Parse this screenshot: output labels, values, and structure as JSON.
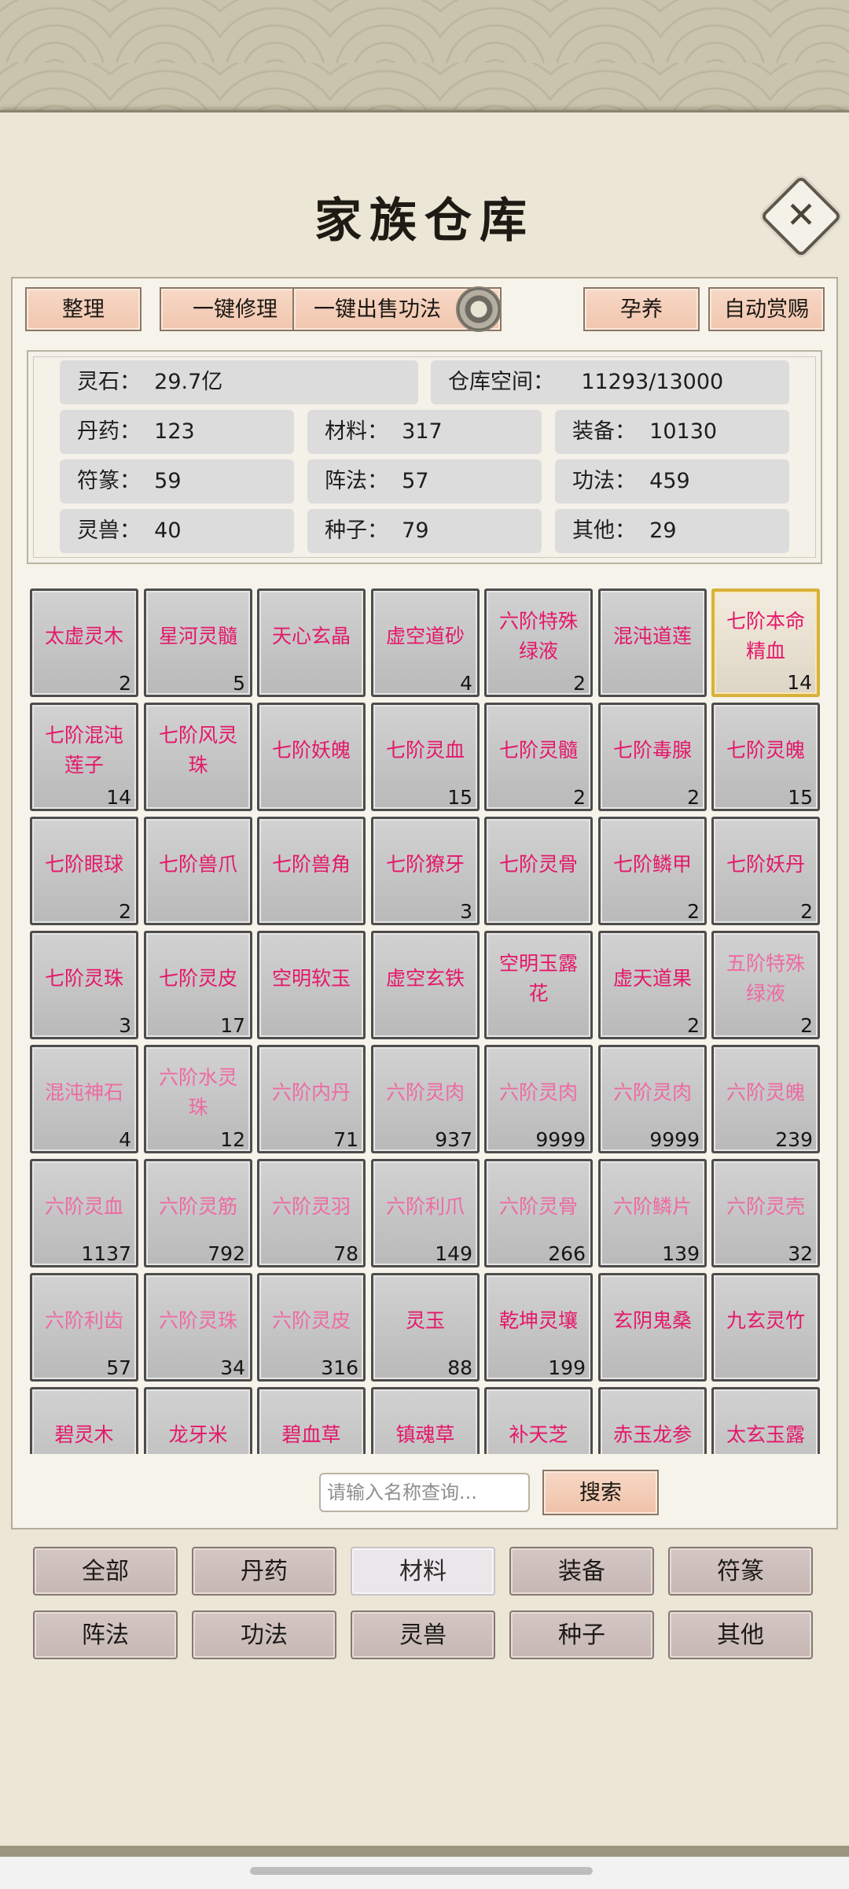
{
  "title": "家族仓库",
  "toolbar": {
    "sort": "整理",
    "repair_all": "一键修理",
    "sell_skills": "一键出售功法",
    "nurture": "孕养",
    "auto_reward": "自动赏赐"
  },
  "stats": {
    "spirit_stone": "灵石：  29.7亿",
    "capacity": "仓库空间：    11293/13000",
    "pills": "丹药：  123",
    "materials": "材料：  317",
    "equipment": "装备：  10130",
    "talismans": "符篆：  59",
    "formations": "阵法：  57",
    "skills": "功法：  459",
    "beasts": "灵兽：  40",
    "seeds": "种子：  79",
    "other": "其他：  29"
  },
  "items": [
    {
      "name": "太虚灵木",
      "count": "2"
    },
    {
      "name": "星河灵髓",
      "count": "5"
    },
    {
      "name": "天心玄晶",
      "count": ""
    },
    {
      "name": "虚空道砂",
      "count": "4"
    },
    {
      "name": "六阶特殊绿液",
      "count": "2"
    },
    {
      "name": "混沌道莲",
      "count": ""
    },
    {
      "name": "七阶本命精血",
      "count": "14"
    },
    {
      "name": "七阶混沌莲子",
      "count": "14"
    },
    {
      "name": "七阶风灵珠",
      "count": ""
    },
    {
      "name": "七阶妖魄",
      "count": ""
    },
    {
      "name": "七阶灵血",
      "count": "15"
    },
    {
      "name": "七阶灵髓",
      "count": "2"
    },
    {
      "name": "七阶毒腺",
      "count": "2"
    },
    {
      "name": "七阶灵魄",
      "count": "15"
    },
    {
      "name": "七阶眼球",
      "count": "2"
    },
    {
      "name": "七阶兽爪",
      "count": ""
    },
    {
      "name": "七阶兽角",
      "count": ""
    },
    {
      "name": "七阶獠牙",
      "count": "3"
    },
    {
      "name": "七阶灵骨",
      "count": ""
    },
    {
      "name": "七阶鳞甲",
      "count": "2"
    },
    {
      "name": "七阶妖丹",
      "count": "2"
    },
    {
      "name": "七阶灵珠",
      "count": "3"
    },
    {
      "name": "七阶灵皮",
      "count": "17"
    },
    {
      "name": "空明软玉",
      "count": ""
    },
    {
      "name": "虚空玄铁",
      "count": ""
    },
    {
      "name": "空明玉露花",
      "count": ""
    },
    {
      "name": "虚天道果",
      "count": "2"
    },
    {
      "name": "五阶特殊绿液",
      "count": "2"
    },
    {
      "name": "混沌神石",
      "count": "4"
    },
    {
      "name": "六阶水灵珠",
      "count": "12"
    },
    {
      "name": "六阶内丹",
      "count": "71"
    },
    {
      "name": "六阶灵肉",
      "count": "937"
    },
    {
      "name": "六阶灵肉",
      "count": "9999"
    },
    {
      "name": "六阶灵肉",
      "count": "9999"
    },
    {
      "name": "六阶灵魄",
      "count": "239"
    },
    {
      "name": "六阶灵血",
      "count": "1137"
    },
    {
      "name": "六阶灵筋",
      "count": "792"
    },
    {
      "name": "六阶灵羽",
      "count": "78"
    },
    {
      "name": "六阶利爪",
      "count": "149"
    },
    {
      "name": "六阶灵骨",
      "count": "266"
    },
    {
      "name": "六阶鳞片",
      "count": "139"
    },
    {
      "name": "六阶灵壳",
      "count": "32"
    },
    {
      "name": "六阶利齿",
      "count": "57"
    },
    {
      "name": "六阶灵珠",
      "count": "34"
    },
    {
      "name": "六阶灵皮",
      "count": "316"
    },
    {
      "name": "灵玉",
      "count": "88"
    },
    {
      "name": "乾坤灵壤",
      "count": "199"
    },
    {
      "name": "玄阴鬼桑",
      "count": ""
    },
    {
      "name": "九玄灵竹",
      "count": ""
    },
    {
      "name": "碧灵木",
      "count": ""
    },
    {
      "name": "龙牙米",
      "count": ""
    },
    {
      "name": "碧血草",
      "count": ""
    },
    {
      "name": "镇魂草",
      "count": ""
    },
    {
      "name": "补天芝",
      "count": ""
    },
    {
      "name": "赤玉龙参",
      "count": ""
    },
    {
      "name": "太玄玉露",
      "count": ""
    }
  ],
  "search": {
    "placeholder": "请输入名称查询...",
    "button": "搜索"
  },
  "categories": [
    "全部",
    "丹药",
    "材料",
    "装备",
    "符篆",
    "阵法",
    "功法",
    "灵兽",
    "种子",
    "其他"
  ],
  "active_category": "材料",
  "colors": {
    "item_name_bright": "#e4186a",
    "item_name_light": "#ee6aa2",
    "selected_border": "#d9b13a",
    "button_bg": "#f1c6ae"
  }
}
